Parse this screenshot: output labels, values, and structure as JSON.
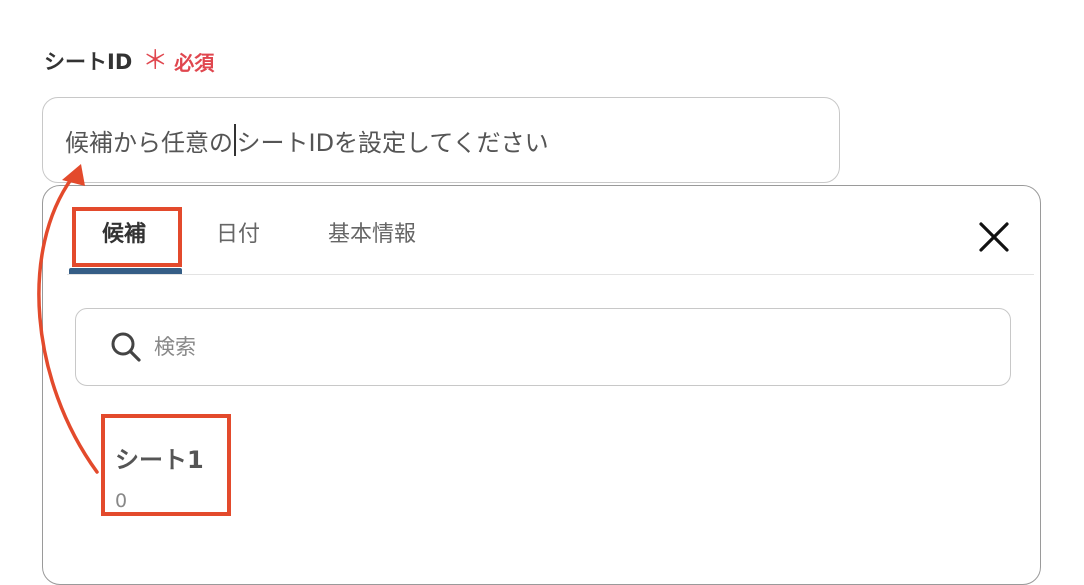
{
  "field": {
    "label": "シートID",
    "required_mark": "＊",
    "required_text": "必須",
    "placeholder_before_caret": "候補から任意の",
    "placeholder_after_caret": "シートIDを設定してください"
  },
  "dropdown": {
    "tabs": [
      {
        "label": "候補",
        "active": true
      },
      {
        "label": "日付",
        "active": false
      },
      {
        "label": "基本情報",
        "active": false
      }
    ],
    "close_icon": "close-icon",
    "search": {
      "placeholder": "検索",
      "icon": "search-icon"
    },
    "items": [
      {
        "title": "シート1",
        "subtitle": "0"
      }
    ]
  },
  "colors": {
    "accent_tab": "#355e86",
    "required": "#e0474f",
    "annotation": "#e34a2c"
  }
}
